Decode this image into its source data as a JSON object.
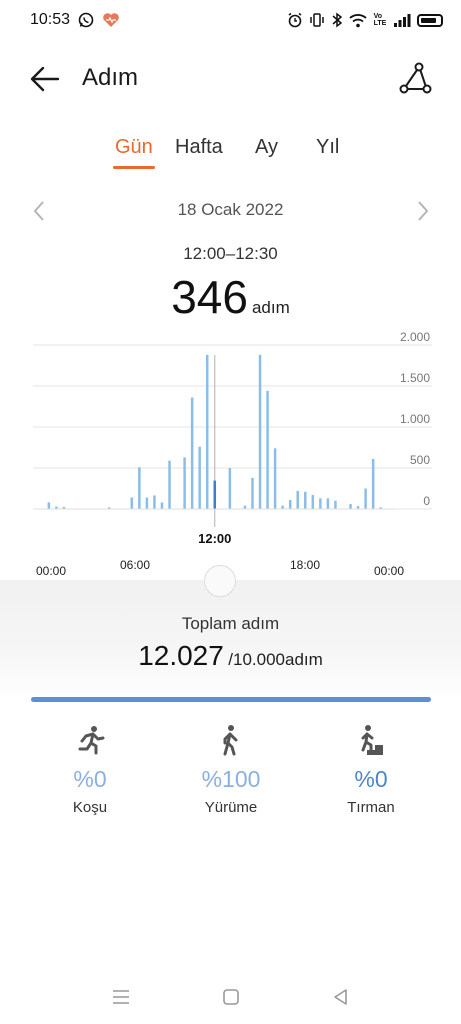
{
  "status": {
    "time": "10:53",
    "left_icons": [
      "whatsapp-icon",
      "heart-icon"
    ],
    "right_icons": [
      "alarm-icon",
      "vibrate-icon",
      "bluetooth-icon",
      "wifi-icon",
      "volte-icon",
      "signal-icon",
      "battery-icon"
    ],
    "volte": "Vo\nLTE"
  },
  "header": {
    "title": "Adım"
  },
  "tabs": [
    {
      "label": "Gün",
      "active": true
    },
    {
      "label": "Hafta",
      "active": false
    },
    {
      "label": "Ay",
      "active": false
    },
    {
      "label": "Yıl",
      "active": false
    }
  ],
  "date": {
    "label": "18 Ocak 2022"
  },
  "selection": {
    "range": "12:00–12:30",
    "value": "346",
    "unit": "adım"
  },
  "chart_data": {
    "type": "bar",
    "x_unit": "hour",
    "x_range": [
      0,
      24
    ],
    "bin_hours": 0.5,
    "ylim": [
      0,
      2000
    ],
    "y_ticks": [
      "2.000",
      "1.500",
      "1.000",
      "500",
      "0"
    ],
    "y_tick_values": [
      2000,
      1500,
      1000,
      500,
      0
    ],
    "x_tick_labels": [
      "00:00",
      "06:00",
      "12:00",
      "18:00",
      "00:00"
    ],
    "x_tick_values": [
      0,
      6,
      12,
      18,
      24
    ],
    "selected_label": "12:00",
    "selected_bin": 12.0,
    "grid": true,
    "color": "#8cbde8",
    "selected_color": "#3a7fd0",
    "bars": [
      {
        "t": 1.0,
        "v": 80
      },
      {
        "t": 1.5,
        "v": 30
      },
      {
        "t": 2.0,
        "v": 25
      },
      {
        "t": 5.0,
        "v": 20
      },
      {
        "t": 6.5,
        "v": 140
      },
      {
        "t": 7.0,
        "v": 510
      },
      {
        "t": 7.5,
        "v": 140
      },
      {
        "t": 8.0,
        "v": 165
      },
      {
        "t": 8.5,
        "v": 80
      },
      {
        "t": 9.0,
        "v": 590
      },
      {
        "t": 10.0,
        "v": 630
      },
      {
        "t": 10.5,
        "v": 1360
      },
      {
        "t": 11.0,
        "v": 760
      },
      {
        "t": 11.5,
        "v": 1880
      },
      {
        "t": 12.0,
        "v": 346
      },
      {
        "t": 13.0,
        "v": 500
      },
      {
        "t": 14.0,
        "v": 40
      },
      {
        "t": 14.5,
        "v": 380
      },
      {
        "t": 15.0,
        "v": 1880
      },
      {
        "t": 15.5,
        "v": 1440
      },
      {
        "t": 16.0,
        "v": 740
      },
      {
        "t": 16.5,
        "v": 40
      },
      {
        "t": 17.0,
        "v": 110
      },
      {
        "t": 17.5,
        "v": 220
      },
      {
        "t": 18.0,
        "v": 210
      },
      {
        "t": 18.5,
        "v": 170
      },
      {
        "t": 19.0,
        "v": 130
      },
      {
        "t": 19.5,
        "v": 130
      },
      {
        "t": 20.0,
        "v": 100
      },
      {
        "t": 21.0,
        "v": 60
      },
      {
        "t": 21.5,
        "v": 35
      },
      {
        "t": 22.0,
        "v": 250
      },
      {
        "t": 22.5,
        "v": 610
      },
      {
        "t": 23.0,
        "v": 20
      }
    ]
  },
  "summary": {
    "label": "Toplam adım",
    "total": "12.027",
    "goal": "/10.000adım",
    "progress": 1.0,
    "bar_color": "#5b8fd6"
  },
  "activities": [
    {
      "icon": "running-icon",
      "percent": "%0",
      "label": "Koşu",
      "tone": "light"
    },
    {
      "icon": "walking-icon",
      "percent": "%100",
      "label": "Yürüme",
      "tone": "light"
    },
    {
      "icon": "climbing-icon",
      "percent": "%0",
      "label": "Tırman",
      "tone": "dark"
    }
  ]
}
